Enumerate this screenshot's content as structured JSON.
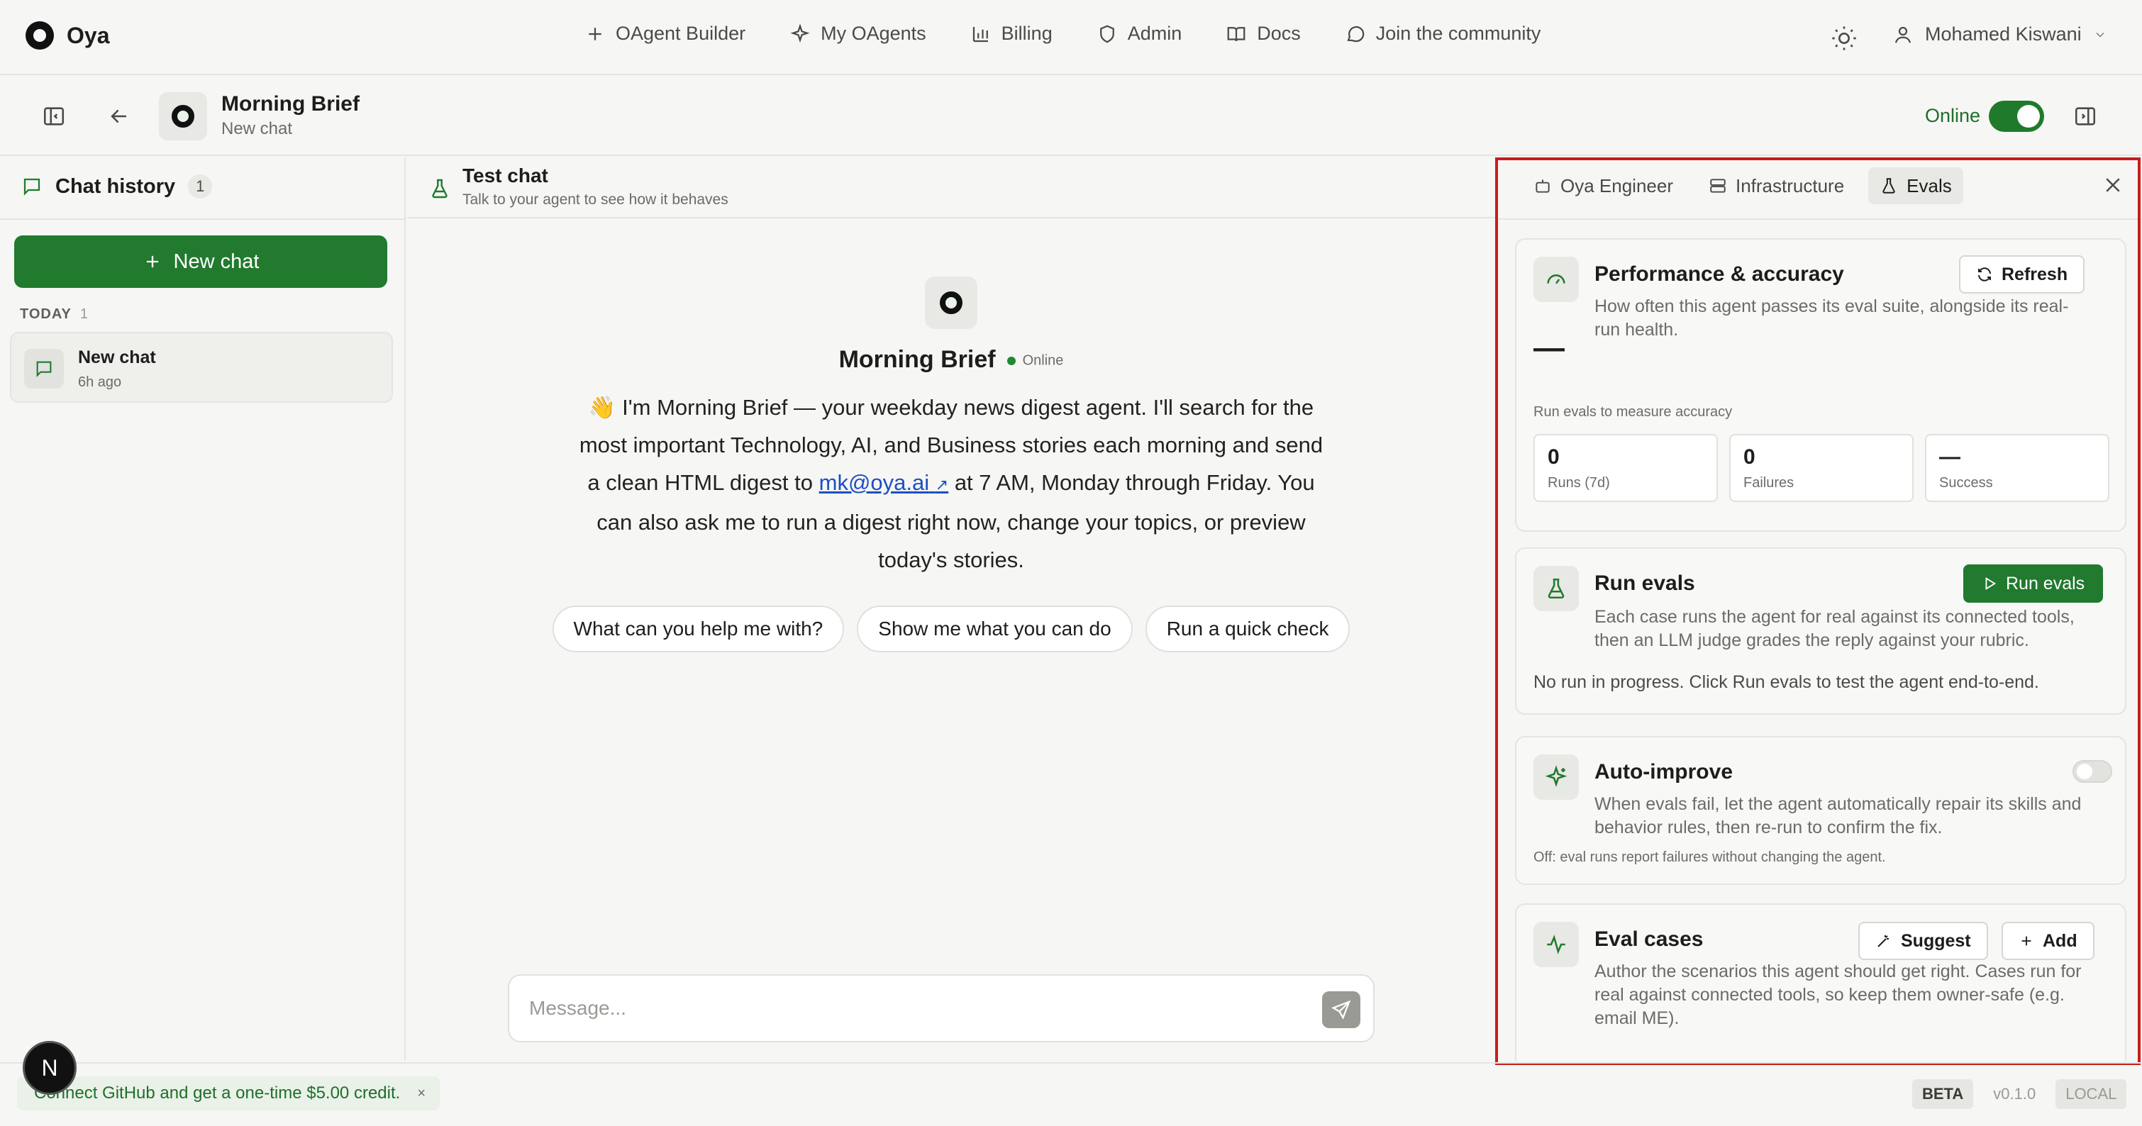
{
  "app": {
    "name": "Oya"
  },
  "nav": {
    "items": [
      {
        "label": "OAgent Builder",
        "icon": "plus-icon"
      },
      {
        "label": "My OAgents",
        "icon": "sparkle-icon"
      },
      {
        "label": "Billing",
        "icon": "bar-chart-icon"
      },
      {
        "label": "Admin",
        "icon": "shield-icon"
      },
      {
        "label": "Docs",
        "icon": "book-icon"
      },
      {
        "label": "Join the community",
        "icon": "chat-bubble-icon"
      }
    ]
  },
  "user": {
    "name": "Mohamed Kiswani"
  },
  "agent": {
    "name": "Morning Brief",
    "subtitle": "New chat",
    "status_label": "Online",
    "online": true
  },
  "sidebar": {
    "title": "Chat history",
    "count": "1",
    "new_chat_label": "New chat",
    "group_label": "TODAY",
    "group_count": "1",
    "chats": [
      {
        "title": "New chat",
        "time": "6h ago"
      }
    ]
  },
  "test_chat": {
    "title": "Test chat",
    "subtitle": "Talk to your agent to see how it behaves",
    "agent_name": "Morning Brief",
    "agent_status": "Online",
    "intro_before": "👋 I'm Morning Brief — your weekday news digest agent. I'll search for the most important Technology, AI, and Business stories each morning and send a clean HTML digest to ",
    "intro_link": "mk@oya.ai",
    "intro_link_icon": "↗",
    "intro_after": " at 7 AM, Monday through Friday. You can also ask me to run a digest right now, change your topics, or preview today's stories.",
    "suggestions": [
      "What can you help me with?",
      "Show me what you can do",
      "Run a quick check"
    ],
    "composer_placeholder": "Message..."
  },
  "panel": {
    "tabs": [
      {
        "label": "Oya Engineer",
        "icon": "robot-icon",
        "active": false
      },
      {
        "label": "Infrastructure",
        "icon": "server-icon",
        "active": false
      },
      {
        "label": "Evals",
        "icon": "flask-icon",
        "active": true
      }
    ],
    "performance": {
      "title": "Performance & accuracy",
      "refresh_label": "Refresh",
      "description": "How often this agent passes its eval suite, alongside its real-run health.",
      "accuracy_value": "—",
      "accuracy_note": "Run evals to measure accuracy",
      "stats": [
        {
          "value": "0",
          "label": "Runs (7d)"
        },
        {
          "value": "0",
          "label": "Failures"
        },
        {
          "value": "—",
          "label": "Success"
        }
      ]
    },
    "run_evals": {
      "title": "Run evals",
      "button_label": "Run evals",
      "description": "Each case runs the agent for real against its connected tools, then an LLM judge grades the reply against your rubric.",
      "status": "No run in progress. Click Run evals to test the agent end-to-end."
    },
    "auto_improve": {
      "title": "Auto-improve",
      "enabled": false,
      "description": "When evals fail, let the agent automatically repair its skills and behavior rules, then re-run to confirm the fix.",
      "note": "Off: eval runs report failures without changing the agent."
    },
    "eval_cases": {
      "title": "Eval cases",
      "suggest_label": "Suggest",
      "add_label": "Add",
      "description": "Author the scenarios this agent should get right. Cases run for real against connected tools, so keep them owner-safe (e.g. email ME)."
    }
  },
  "footer": {
    "promo": "Connect GitHub and get a one-time $5.00 credit.",
    "promo_close": "×",
    "badge": "N",
    "tags": [
      "BETA",
      "v0.1.0",
      "LOCAL"
    ]
  },
  "colors": {
    "accent": "#217a2e",
    "link": "#1d4fc2",
    "highlight_outline": "#c81d1d"
  }
}
